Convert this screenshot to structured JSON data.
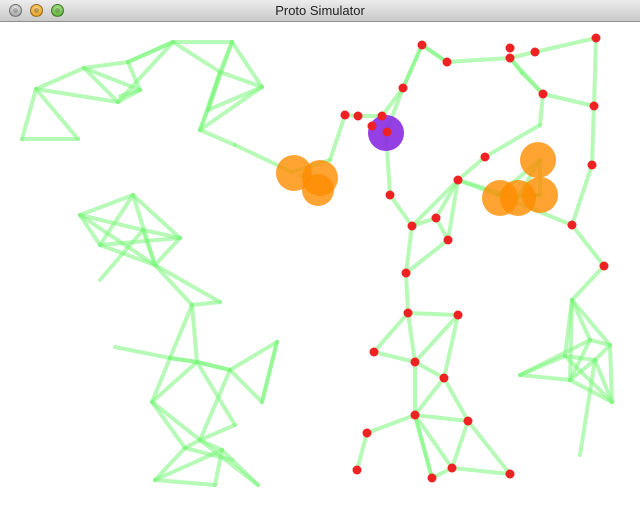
{
  "window": {
    "title": "Proto Simulator"
  },
  "colors": {
    "edge": "#7cf57c",
    "device": "#ee2222",
    "actuator": "#ff8c00",
    "selected": "#8a2be2"
  },
  "icons": [
    "close-button",
    "minimize-button",
    "zoom-button"
  ]
}
